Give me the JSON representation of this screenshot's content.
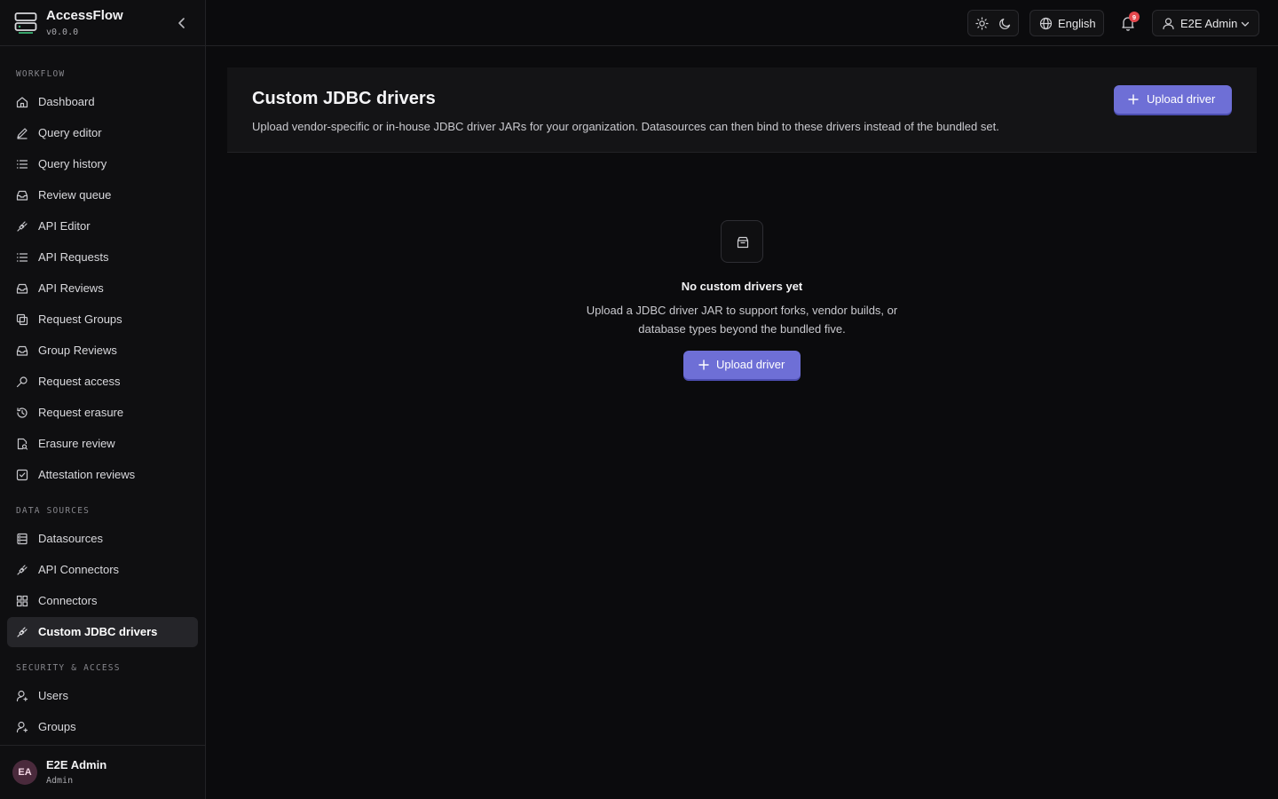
{
  "app": {
    "name": "AccessFlow",
    "version": "v0.0.0"
  },
  "topbar": {
    "language": "English",
    "notification_count": "9",
    "user_name": "E2E Admin"
  },
  "sidebar": {
    "sections": [
      {
        "title": "WORKFLOW"
      },
      {
        "title": "DATA SOURCES"
      },
      {
        "title": "SECURITY & ACCESS"
      }
    ],
    "items": [
      {
        "label": "Dashboard",
        "icon": "home-icon"
      },
      {
        "label": "Query editor",
        "icon": "pencil-icon"
      },
      {
        "label": "Query history",
        "icon": "list-icon"
      },
      {
        "label": "Review queue",
        "icon": "inbox-icon"
      },
      {
        "label": "API Editor",
        "icon": "plug-icon"
      },
      {
        "label": "API Requests",
        "icon": "list-icon"
      },
      {
        "label": "API Reviews",
        "icon": "inbox-icon"
      },
      {
        "label": "Request Groups",
        "icon": "copy-icon"
      },
      {
        "label": "Group Reviews",
        "icon": "inbox-icon"
      },
      {
        "label": "Request access",
        "icon": "key-icon"
      },
      {
        "label": "Request erasure",
        "icon": "history-icon"
      },
      {
        "label": "Erasure review",
        "icon": "file-search-icon"
      },
      {
        "label": "Attestation reviews",
        "icon": "check-square-icon"
      },
      {
        "label": "Datasources",
        "icon": "database-icon"
      },
      {
        "label": "API Connectors",
        "icon": "plug-icon"
      },
      {
        "label": "Connectors",
        "icon": "grid-icon"
      },
      {
        "label": "Custom JDBC drivers",
        "icon": "plug-icon"
      },
      {
        "label": "Users",
        "icon": "user-cog-icon"
      },
      {
        "label": "Groups",
        "icon": "user-cog-icon"
      }
    ],
    "active_item": "Custom JDBC drivers",
    "footer": {
      "initials": "EA",
      "name": "E2E Admin",
      "role": "Admin"
    }
  },
  "main": {
    "title": "Custom JDBC drivers",
    "description": "Upload vendor-specific or in-house JDBC driver JARs for your organization. Datasources can then bind to these drivers instead of the bundled set.",
    "upload_label": "Upload driver",
    "empty_state": {
      "title": "No custom drivers yet",
      "description": "Upload a JDBC driver JAR to support forks, vendor builds, or database types beyond the bundled five.",
      "button_label": "Upload driver"
    }
  },
  "colors": {
    "accent": "#6e6fd6",
    "badge": "#e5484d",
    "active_bg": "#252529"
  }
}
